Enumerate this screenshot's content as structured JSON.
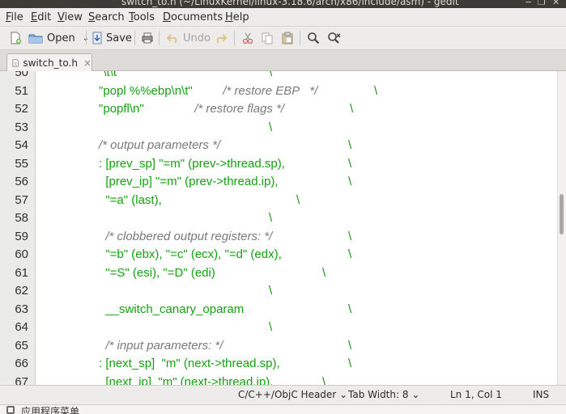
{
  "window": {
    "title": "switch_to.h (~/LinuxKernel/linux-3.18.6/arch/x86/include/asm) - gedit",
    "minimize_glyph": "−",
    "maximize_glyph": "❐",
    "close_glyph": "✕"
  },
  "menubar": {
    "items": [
      {
        "underline": "F",
        "rest": "ile"
      },
      {
        "underline": "E",
        "rest": "dit"
      },
      {
        "underline": "V",
        "rest": "iew"
      },
      {
        "underline": "S",
        "rest": "earch"
      },
      {
        "underline": "T",
        "rest": "ools"
      },
      {
        "underline": "D",
        "rest": "ocuments"
      },
      {
        "underline": "H",
        "rest": "elp"
      }
    ]
  },
  "toolbar": {
    "open_label": "Open",
    "save_label": "Save",
    "undo_label": "Undo",
    "icons": [
      "new-file-icon",
      "open-folder-icon",
      "save-icon",
      "print-icon",
      "undo-icon",
      "redo-icon",
      "cut-icon",
      "copy-icon",
      "paste-icon",
      "find-icon",
      "find-replace-icon"
    ]
  },
  "tabs": [
    {
      "label": "switch_to.h",
      "close": "×",
      "active": true
    }
  ],
  "editor": {
    "lines": [
      {
        "n": "50",
        "segments": [
          {
            "t": "\"\\t\\t\"",
            "c": "str"
          }
        ],
        "backslash": "\\"
      },
      {
        "n": "51",
        "segments": [
          {
            "t": "\"popl %%ebp\\n\\t\"",
            "c": "str"
          },
          {
            "t": "         /* restore EBP   */",
            "c": "cmt"
          }
        ],
        "backslash": "\\"
      },
      {
        "n": "52",
        "segments": [
          {
            "t": "\"popfl\\n\"",
            "c": "str"
          },
          {
            "t": "               /* restore flags */",
            "c": "cmt"
          }
        ],
        "backslash": "\\"
      },
      {
        "n": "53",
        "segments": [],
        "backslash": "\\"
      },
      {
        "n": "54",
        "segments": [
          {
            "t": "/* output parameters */",
            "c": "cmt"
          }
        ],
        "backslash": "\\"
      },
      {
        "n": "55",
        "segments": [
          {
            "t": ": [prev_sp] \"=m\" (prev->thread.sp),",
            "c": "str"
          }
        ],
        "backslash": "\\"
      },
      {
        "n": "56",
        "segments": [
          {
            "t": "  [prev_ip] \"=m\" (prev->thread.ip),",
            "c": "str"
          }
        ],
        "backslash": "\\"
      },
      {
        "n": "57",
        "segments": [
          {
            "t": "  \"=a\" (last),",
            "c": "str"
          }
        ],
        "backslash": "\\"
      },
      {
        "n": "58",
        "segments": [],
        "backslash": "\\"
      },
      {
        "n": "59",
        "segments": [
          {
            "t": "  /* clobbered output registers: */",
            "c": "cmt"
          }
        ],
        "backslash": "\\"
      },
      {
        "n": "60",
        "segments": [
          {
            "t": "  \"=b\" (ebx), \"=c\" (ecx), \"=d\" (edx),",
            "c": "str"
          }
        ],
        "backslash": "\\"
      },
      {
        "n": "61",
        "segments": [
          {
            "t": "  \"=S\" (esi), \"=D\" (edi)",
            "c": "str"
          }
        ],
        "backslash": "\\"
      },
      {
        "n": "62",
        "segments": [],
        "backslash": "\\"
      },
      {
        "n": "63",
        "segments": [
          {
            "t": "  __switch_canary_oparam",
            "c": "str"
          }
        ],
        "backslash": "\\"
      },
      {
        "n": "64",
        "segments": [],
        "backslash": "\\"
      },
      {
        "n": "65",
        "segments": [
          {
            "t": "  /* input parameters: */",
            "c": "cmt"
          }
        ],
        "backslash": "\\"
      },
      {
        "n": "66",
        "segments": [
          {
            "t": ": [next_sp]  \"m\" (next->thread.sp),",
            "c": "str"
          }
        ],
        "backslash": "\\"
      },
      {
        "n": "67",
        "segments": [
          {
            "t": "  [next_ip]  \"m\" (next->thread.ip),",
            "c": "str"
          }
        ],
        "backslash": "\\"
      }
    ]
  },
  "statusbar": {
    "language": "C/C++/ObjC Header",
    "tab_width": "Tab Width: 8",
    "position": "Ln 1, Col 1",
    "mode": "INS"
  },
  "panel": {
    "label": "应用程序菜单"
  },
  "colors": {
    "string": "#13a10e",
    "comment": "#7a7a7a",
    "background": "#ffffff"
  }
}
